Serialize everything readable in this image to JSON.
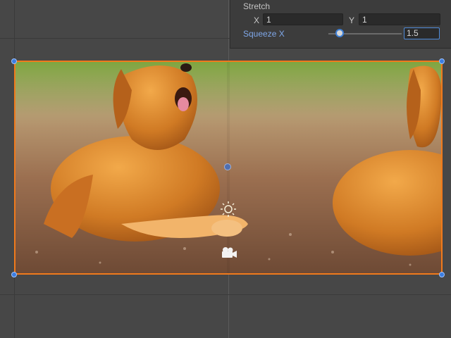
{
  "inspector": {
    "section_title": "Stretch",
    "x_label": "X",
    "x_value": "1",
    "y_label": "Y",
    "y_value": "1",
    "squeeze_label": "Squeeze X",
    "squeeze_value": "1.5",
    "squeeze_slider_fraction": 0.15
  },
  "scene": {
    "image_subject": "golden retriever dog sitting on dirt ground",
    "image_tiling": "stretched and repeated horizontally",
    "icons": [
      "sun-light-icon",
      "camera-icon",
      "pivot-icon"
    ]
  },
  "colors": {
    "selection_outline": "#f07a1c",
    "handle": "#3b7de0",
    "accent_label": "#7fa7e8"
  }
}
